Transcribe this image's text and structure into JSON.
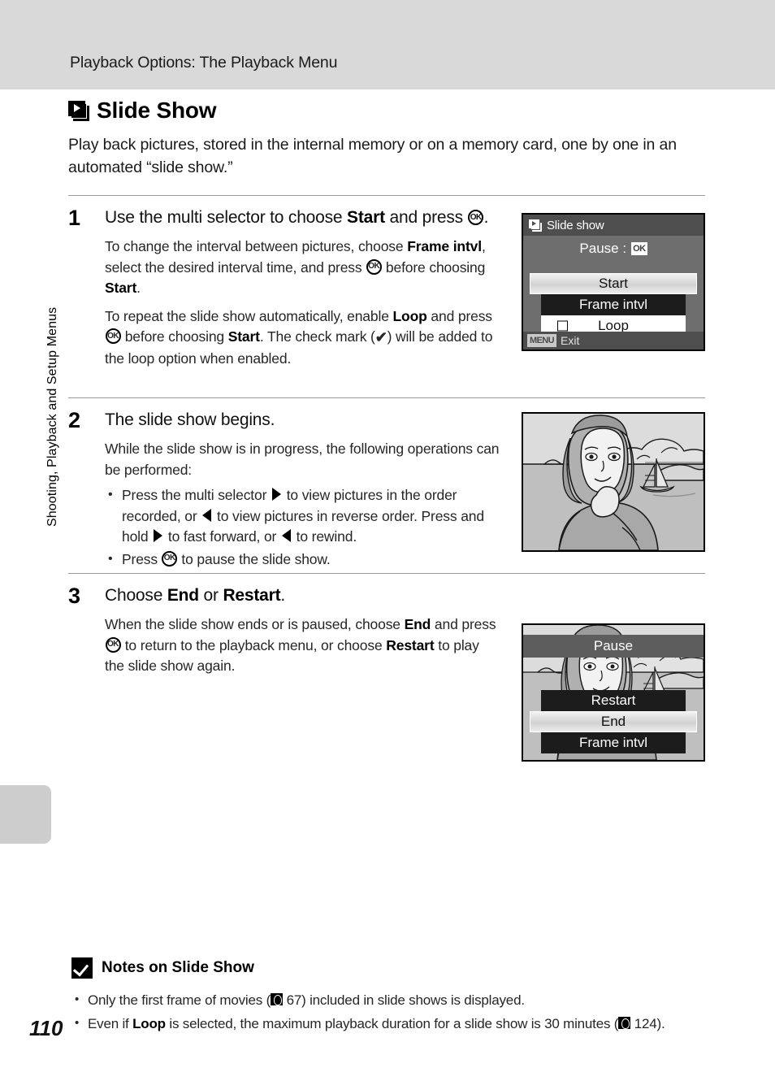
{
  "header": {
    "title": "Playback Options: The Playback Menu"
  },
  "side": {
    "chapter_label": "Shooting, Playback and Setup Menus",
    "page_number": "110"
  },
  "section": {
    "icon": "slideshow-stack-icon",
    "title": "Slide Show",
    "intro": "Play back pictures, stored in the internal memory or on a memory card, one by one in an automated “slide show.”"
  },
  "steps": [
    {
      "number": "1",
      "heading_parts": [
        "Use the multi selector to choose ",
        "Start",
        " and press ",
        "OK",
        "."
      ],
      "paragraph1_parts": [
        "To change the interval between pictures, choose ",
        "Frame intvl",
        ", select the desired interval time, and press ",
        "OK",
        " before choosing ",
        "Start",
        "."
      ],
      "paragraph2_parts": [
        "To repeat the slide show automatically, enable ",
        "Loop",
        " and press ",
        "OK",
        " before choosing ",
        "Start",
        ". The check mark (",
        "✔",
        ") will be added to the loop option when enabled."
      ]
    },
    {
      "number": "2",
      "heading": "The slide show begins.",
      "paragraph": "While the slide show is in progress, the following operations can be performed:",
      "bullets": [
        "Press the multi selector ▶ to view pictures in the order recorded, or ◀ to view pictures in reverse order. Press and hold ▶ to fast forward, or ◀ to rewind.",
        "Press OK to pause the slide show."
      ]
    },
    {
      "number": "3",
      "heading_parts": [
        "Choose ",
        "End",
        " or ",
        "Restart",
        "."
      ],
      "paragraph_parts": [
        "When the slide show ends or is paused, choose ",
        "End",
        " and press ",
        "OK",
        " to return to the playback menu, or choose ",
        "Restart",
        " to play the slide show again."
      ]
    }
  ],
  "lcd_slideshow_menu": {
    "title": "Slide show",
    "pause_label": "Pause :",
    "pause_button": "OK",
    "items": [
      {
        "label": "Start",
        "state": "selected"
      },
      {
        "label": "Frame intvl",
        "state": "normal"
      },
      {
        "label": "Loop",
        "state": "checkbox",
        "checked": false
      }
    ],
    "footer_button": "MENU",
    "footer_label": "Exit"
  },
  "lcd_paused": {
    "status": "Pause",
    "items": [
      {
        "label": "Restart",
        "state": "normal"
      },
      {
        "label": "End",
        "state": "selected"
      },
      {
        "label": "Frame intvl",
        "state": "normal"
      }
    ]
  },
  "figure_photo": {
    "description": "Woman in foreground with sailboat, sea and mountains"
  },
  "notes": {
    "icon": "checkmark-badge-icon",
    "title": "Notes on Slide Show",
    "items": [
      {
        "parts": [
          "Only the first frame of movies (",
          "67",
          ") included in slide shows is displayed."
        ],
        "ref": "67"
      },
      {
        "parts": [
          "Even if ",
          "Loop",
          " is selected, the maximum playback duration for a slide show is 30 minutes (",
          "124",
          ")."
        ],
        "ref": "124"
      }
    ]
  },
  "colors": {
    "header_band": "#d9d9d9",
    "side_tab": "#cdcdcd",
    "lcd_body": "#6e6e6e",
    "lcd_bar": "#4e4e4e",
    "menu_dark": "#1c1c1c"
  }
}
